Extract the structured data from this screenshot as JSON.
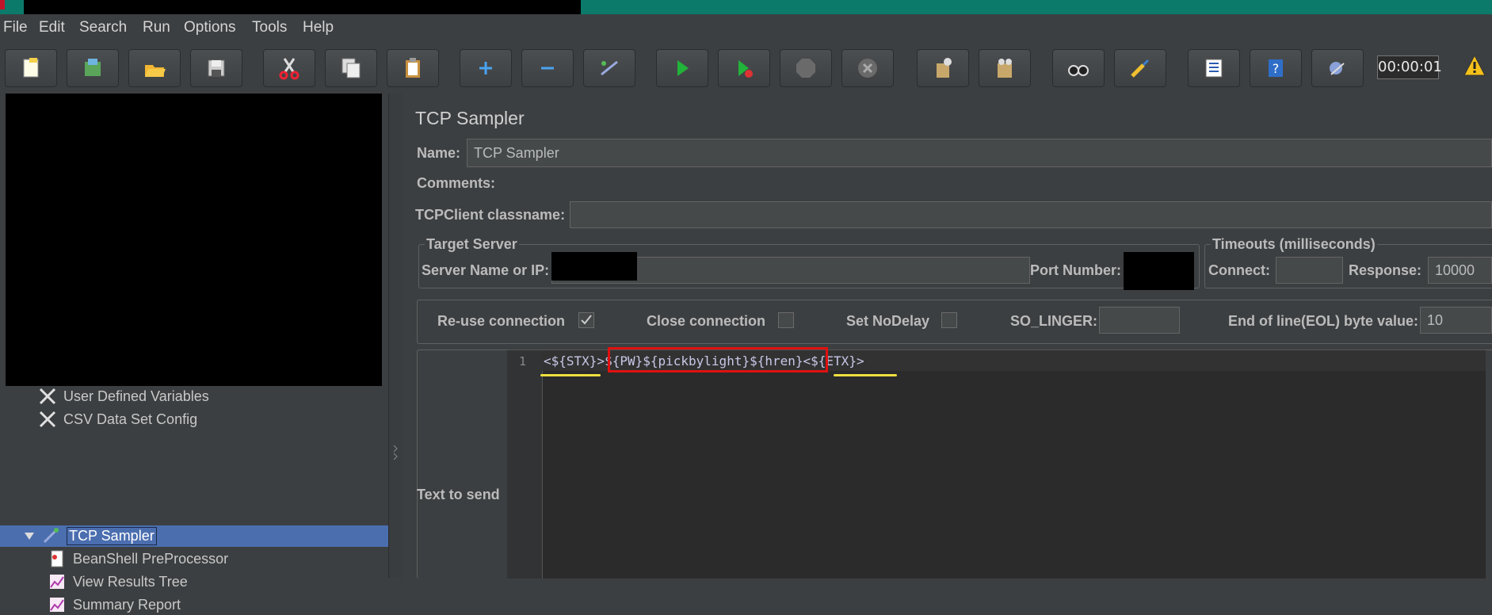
{
  "menu": [
    "File",
    "Edit",
    "Search",
    "Run",
    "Options",
    "Tools",
    "Help"
  ],
  "toolbar": {
    "buttons": [
      "new-icon",
      "templates-icon",
      "open-icon",
      "save-icon",
      "cut-icon",
      "copy-icon",
      "paste-icon",
      "expand-icon",
      "collapse-icon",
      "toggle-icon",
      "start-icon",
      "start-no-pause-icon",
      "stop-icon",
      "shutdown-icon",
      "clear-icon",
      "clear-all-icon",
      "search-icon",
      "reset-search-icon",
      "function-helper-icon",
      "help-icon",
      "remote-icon"
    ],
    "timer": "00:00:01"
  },
  "tree": {
    "items": [
      {
        "label": "User Defined Variables",
        "icon": "wrench-icon"
      },
      {
        "label": "CSV Data Set Config",
        "icon": "wrench-icon"
      },
      {
        "label": "TCP Sampler",
        "icon": "pipette-icon",
        "selected": true
      },
      {
        "label": "BeanShell PreProcessor",
        "icon": "script-icon"
      },
      {
        "label": "View Results Tree",
        "icon": "graph-icon"
      },
      {
        "label": "Summary Report",
        "icon": "graph-icon"
      }
    ]
  },
  "sampler": {
    "title": "TCP Sampler",
    "name_label": "Name:",
    "name_value": "TCP Sampler",
    "comments_label": "Comments:",
    "classname_label": "TCPClient classname:",
    "classname_value": "",
    "target_server_title": "Target Server",
    "server_label": "Server Name or IP:",
    "port_label": "Port Number:",
    "timeouts_title": "Timeouts (milliseconds)",
    "connect_label": "Connect:",
    "connect_value": "",
    "response_label": "Response:",
    "response_value": "10000",
    "reuse_label": "Re-use connection",
    "reuse_checked": true,
    "close_label": "Close connection",
    "nodelay_label": "Set NoDelay",
    "solinger_label": "SO_LINGER:",
    "eol_label": "End of line(EOL) byte value:",
    "eol_value": "10",
    "text_to_send_label": "Text to send",
    "line_number": "1",
    "code": {
      "part1": "<${STX}>",
      "part2": "${PW}${pickbylight}${hren}",
      "part3": "<${ETX}>"
    }
  },
  "colors": {
    "selection": "#4b6eaf",
    "highlight_box": "#e01010",
    "underline": "#f0e040"
  }
}
